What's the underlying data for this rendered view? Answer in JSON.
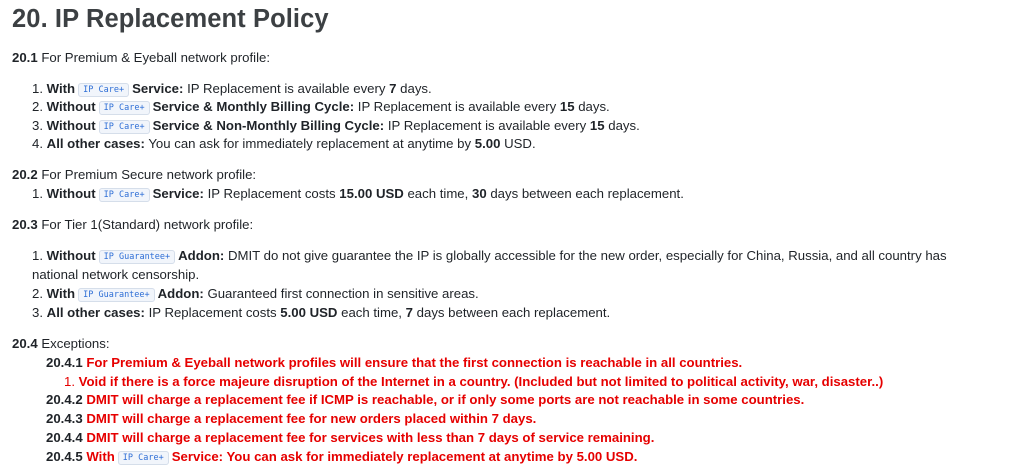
{
  "title": "20. IP Replacement Policy",
  "tags": {
    "ipcare": "IP Care+",
    "ipguarantee": "IP Guarantee+"
  },
  "s1": {
    "num": "20.1",
    "text": "For Premium & Eyeball network profile:",
    "i1": {
      "n": "1.",
      "a": "With",
      "b": "Service:",
      "c": "IP Replacement is available every",
      "v": "7",
      "d": "days."
    },
    "i2": {
      "n": "2.",
      "a": "Without",
      "b": "Service & Monthly Billing Cycle:",
      "c": "IP Replacement is available every",
      "v": "15",
      "d": "days."
    },
    "i3": {
      "n": "3.",
      "a": "Without",
      "b": "Service & Non-Monthly Billing Cycle:",
      "c": "IP Replacement is available every",
      "v": "15",
      "d": "days."
    },
    "i4": {
      "n": "4.",
      "a": "All other cases:",
      "c": "You can ask for immediately replacement at anytime by",
      "v": "5.00",
      "d": "USD."
    }
  },
  "s2": {
    "num": "20.2",
    "text": "For Premium Secure network profile:",
    "i1": {
      "n": "1.",
      "a": "Without",
      "b": "Service:",
      "c": "IP Replacement costs",
      "v1": "15.00 USD",
      "m": "each time,",
      "v2": "30",
      "d": "days between each replacement."
    }
  },
  "s3": {
    "num": "20.3",
    "text": "For Tier 1(Standard) network profile:",
    "i1": {
      "n": "1.",
      "a": "Without",
      "b": "Addon:",
      "c": "DMIT do not give guarantee the IP is globally accessible for the new order, especially for China, Russia, and all country has national network censorship."
    },
    "i2": {
      "n": "2.",
      "a": "With",
      "b": "Addon:",
      "c": "Guaranteed first connection in sensitive areas."
    },
    "i3": {
      "n": "3.",
      "a": "All other cases:",
      "c": "IP Replacement costs",
      "v1": "5.00 USD",
      "m": "each time,",
      "v2": "7",
      "d": "days between each replacement."
    }
  },
  "s4": {
    "num": "20.4",
    "text": "Exceptions:",
    "e1": {
      "n": "20.4.1",
      "t": "For Premium & Eyeball network profiles will ensure that the first connection is reachable in all countries."
    },
    "e1a": {
      "n": "1.",
      "t": "Void if there is a force majeure disruption of the Internet in a country. (Included but not limited to political activity, war, disaster..)"
    },
    "e2": {
      "n": "20.4.2",
      "t": "DMIT will charge a replacement fee if ICMP is reachable, or if only some ports are not reachable in some countries."
    },
    "e3": {
      "n": "20.4.3",
      "t": "DMIT will charge a replacement fee for new orders placed within 7 days."
    },
    "e4": {
      "n": "20.4.4",
      "t": "DMIT will charge a replacement fee for services with less than 7 days of service remaining."
    },
    "e5": {
      "n": "20.4.5",
      "a": "With",
      "b": "Service: You can ask for immediately replacement at anytime by 5.00 USD."
    }
  }
}
